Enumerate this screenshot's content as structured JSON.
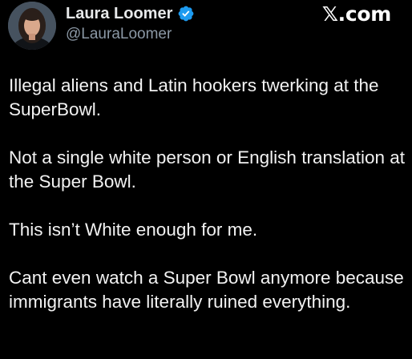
{
  "author": {
    "display_name": "Laura Loomer",
    "handle": "@LauraLoomer",
    "avatar_icon": "profile-photo",
    "verified_icon": "verified-badge-icon",
    "verified_color": "#1d9bf0"
  },
  "brand": {
    "label": "𝕏.com"
  },
  "tweet": {
    "paragraphs": [
      "Illegal aliens and Latin hookers twerking at the SuperBowl.",
      "Not a single white person or English translation at the Super Bowl.",
      "This isn’t White enough for me.",
      "Cant even watch a Super Bowl anymore because immigrants have literally ruined everything."
    ]
  },
  "colors": {
    "background": "#000000",
    "text": "#e7e9ea",
    "secondary_text": "#8b98a5"
  }
}
